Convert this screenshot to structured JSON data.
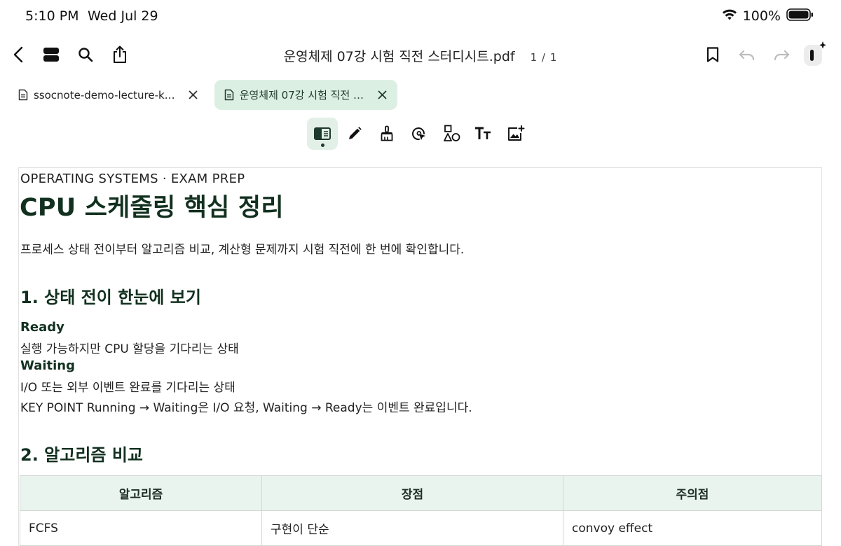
{
  "status": {
    "time": "5:10 PM",
    "date": "Wed Jul 29",
    "battery": "100%"
  },
  "nav": {
    "doc_title": "운영체제 07강 시험 직전 스터디시트.pdf",
    "page_count": "1 / 1"
  },
  "tabs": [
    {
      "label": "ssocnote-demo-lecture-k…"
    },
    {
      "label": "운영체제 07강 시험 직전 …"
    }
  ],
  "document": {
    "eyebrow": "OPERATING SYSTEMS · EXAM PREP",
    "title": "CPU 스케줄링 핵심 정리",
    "intro": "프로세스 상태 전이부터 알고리즘 비교, 계산형 문제까지 시험 직전에 한 번에 확인합니다.",
    "section1": {
      "heading": "1. 상태 전이 한눈에 보기",
      "ready_term": "Ready",
      "ready_desc": "실행 가능하지만 CPU 할당을 기다리는 상태",
      "waiting_term": "Waiting",
      "waiting_desc": "I/O 또는 외부 이벤트 완료를 기다리는 상태",
      "key_point": "KEY POINT Running → Waiting은 I/O 요청, Waiting → Ready는 이벤트 완료입니다."
    },
    "section2": {
      "heading": "2. 알고리즘 비교",
      "columns": [
        "알고리즘",
        "장점",
        "주의점"
      ],
      "rows": [
        [
          "FCFS",
          "구현이 단순",
          "convoy effect"
        ]
      ]
    }
  },
  "colors": {
    "accent": "#12301f",
    "active_tab_bg": "#dcefe3",
    "table_header_bg": "#eaf4ee"
  }
}
